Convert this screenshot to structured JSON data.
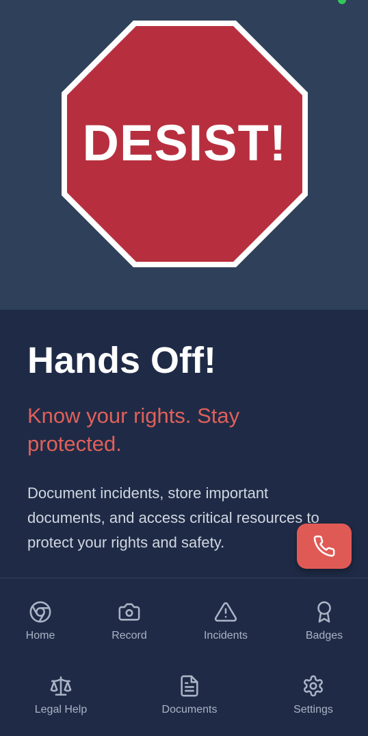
{
  "hero": {
    "sign_text": "DESIST!",
    "sign_color": "#b72f3e",
    "background_color": "#2f405a"
  },
  "content": {
    "title": "Hands Off!",
    "tagline": "Know your rights. Stay protected.",
    "description": "Document incidents, store important documents, and access critical resources to protect your rights and safety.",
    "accent_color": "#e05a55"
  },
  "fab": {
    "icon": "phone-icon",
    "color": "#e05a55"
  },
  "nav": {
    "row1": [
      {
        "label": "Home",
        "icon": "chrome-icon"
      },
      {
        "label": "Record",
        "icon": "camera-icon"
      },
      {
        "label": "Incidents",
        "icon": "warning-icon"
      },
      {
        "label": "Badges",
        "icon": "award-icon"
      }
    ],
    "row2": [
      {
        "label": "Legal Help",
        "icon": "scale-icon"
      },
      {
        "label": "Documents",
        "icon": "document-icon"
      },
      {
        "label": "Settings",
        "icon": "gear-icon"
      }
    ]
  }
}
